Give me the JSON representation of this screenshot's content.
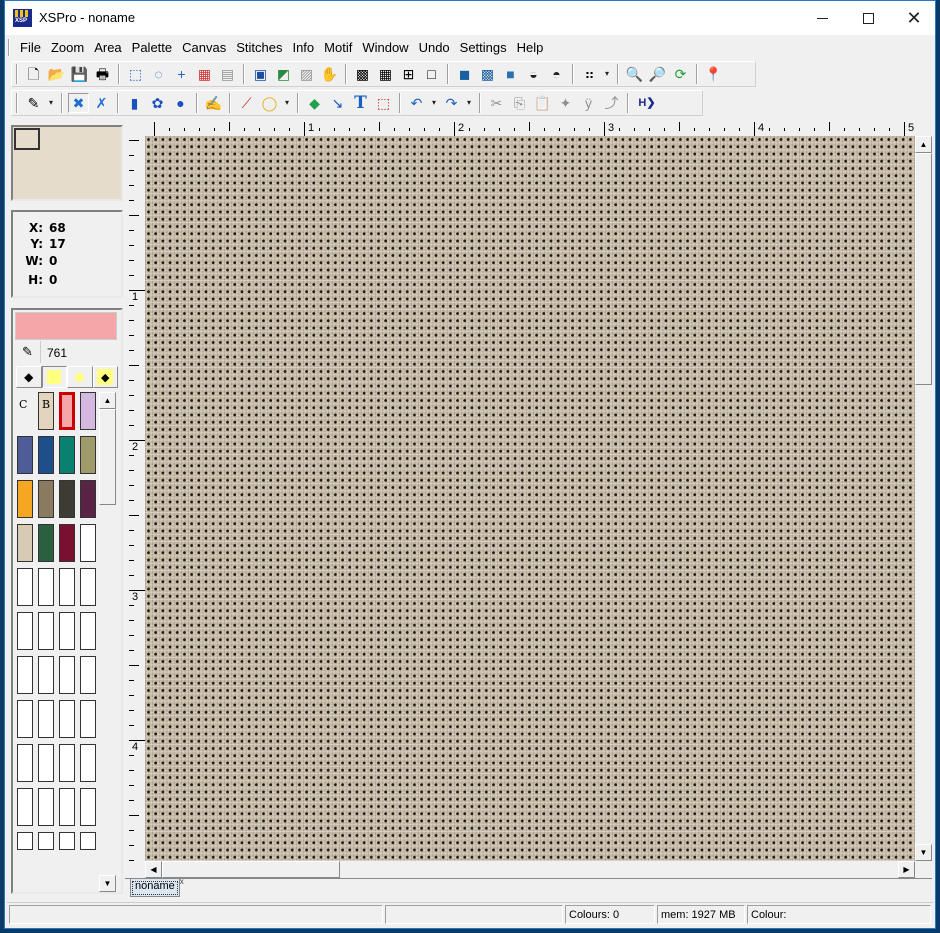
{
  "window": {
    "title": "XSPro - noname",
    "controls": {
      "minimize": "–",
      "maximize": "□",
      "close": "✕"
    }
  },
  "menu": [
    "File",
    "Zoom",
    "Area",
    "Palette",
    "Canvas",
    "Stitches",
    "Info",
    "Motif",
    "Window",
    "Undo",
    "Settings",
    "Help"
  ],
  "toolbar1": [
    {
      "name": "new-file-icon",
      "glyph": "🗋"
    },
    {
      "name": "open-folder-icon",
      "glyph": "📂"
    },
    {
      "name": "save-icon",
      "glyph": "💾"
    },
    {
      "name": "print-icon",
      "glyph": "🖶"
    },
    {
      "sep": true
    },
    {
      "name": "rect-select-icon",
      "glyph": "⬚"
    },
    {
      "name": "lasso-select-icon",
      "glyph": "◌"
    },
    {
      "name": "crosshair-icon",
      "glyph": "+"
    },
    {
      "name": "add-area-icon",
      "glyph": "▦"
    },
    {
      "name": "remove-area-icon",
      "glyph": "▤",
      "disabled": true
    },
    {
      "sep": true
    },
    {
      "name": "screen-view-icon",
      "glyph": "▣"
    },
    {
      "name": "pick-image-icon",
      "glyph": "◩"
    },
    {
      "name": "camera-icon",
      "glyph": "▨",
      "disabled": true
    },
    {
      "name": "hand-pan-icon",
      "glyph": "✋"
    },
    {
      "sep": true
    },
    {
      "name": "grid-fine-icon",
      "glyph": "▩"
    },
    {
      "name": "grid-dense-icon",
      "glyph": "▦"
    },
    {
      "name": "grid-lines-icon",
      "glyph": "⊞"
    },
    {
      "name": "grid-none-icon",
      "glyph": "□"
    },
    {
      "sep": true
    },
    {
      "name": "view-stitches-icon",
      "glyph": "◼"
    },
    {
      "name": "view-symbols-icon",
      "glyph": "▩"
    },
    {
      "name": "view-block-icon",
      "glyph": "■"
    },
    {
      "name": "view-bead-icon",
      "glyph": "◒"
    },
    {
      "name": "view-bead-white-icon",
      "glyph": "◓"
    },
    {
      "sep": true
    },
    {
      "name": "grid-dots-icon",
      "glyph": "⠶"
    },
    {
      "name": "grid-dots-dropdown",
      "glyph": "▾",
      "dd": true
    },
    {
      "sep": true
    },
    {
      "name": "zoom-in-icon",
      "glyph": "🔍"
    },
    {
      "name": "zoom-out-icon",
      "glyph": "🔎"
    },
    {
      "name": "refresh-icon",
      "glyph": "⟳"
    },
    {
      "sep": true
    },
    {
      "name": "colour-picker-icon",
      "glyph": "📍"
    }
  ],
  "toolbar2": [
    {
      "name": "pencil-icon",
      "glyph": "✎"
    },
    {
      "name": "pencil-dropdown",
      "glyph": "▾",
      "dd": true
    },
    {
      "sep": true
    },
    {
      "name": "full-cross-icon",
      "glyph": "✖",
      "active": true
    },
    {
      "name": "half-cross-icon",
      "glyph": "✗"
    },
    {
      "sep": true
    },
    {
      "name": "bead-long-icon",
      "glyph": "▮"
    },
    {
      "name": "french-knot-icon",
      "glyph": "✿"
    },
    {
      "name": "bead-round-icon",
      "glyph": "●"
    },
    {
      "sep": true
    },
    {
      "name": "backstitch-pen-icon",
      "glyph": "✍"
    },
    {
      "sep": true
    },
    {
      "name": "line-icon",
      "glyph": "⟋"
    },
    {
      "name": "circle-icon",
      "glyph": "◯"
    },
    {
      "name": "shape-dropdown",
      "glyph": "▾",
      "dd": true
    },
    {
      "sep": true
    },
    {
      "name": "fill-bucket-icon",
      "glyph": "◆"
    },
    {
      "name": "eyedropper-icon",
      "glyph": "↘"
    },
    {
      "name": "text-tool-icon",
      "glyph": "T"
    },
    {
      "name": "dotted-rect-icon",
      "glyph": "⬚"
    },
    {
      "sep": true
    },
    {
      "name": "undo-icon",
      "glyph": "↶"
    },
    {
      "name": "undo-dropdown",
      "glyph": "▾",
      "dd": true
    },
    {
      "name": "redo-icon",
      "glyph": "↷"
    },
    {
      "name": "redo-dropdown",
      "glyph": "▾",
      "dd": true
    },
    {
      "sep": true
    },
    {
      "name": "cut-icon",
      "glyph": "✂",
      "disabled": true
    },
    {
      "name": "copy-icon",
      "glyph": "⎘",
      "disabled": true
    },
    {
      "name": "paste-icon",
      "glyph": "📋",
      "disabled": true
    },
    {
      "name": "paste-special-icon",
      "glyph": "✦",
      "disabled": true
    },
    {
      "name": "mirror-icon",
      "glyph": "ÿ",
      "disabled": true
    },
    {
      "name": "rotate-icon",
      "glyph": "⤴",
      "disabled": true
    },
    {
      "sep": true
    },
    {
      "name": "h-next-icon",
      "glyph": "H❯"
    }
  ],
  "coords": {
    "x_label": "X:",
    "x": "68",
    "y_label": "Y:",
    "y": "17",
    "w_label": "W:",
    "w": "0",
    "h_label": "H:",
    "h": "0"
  },
  "palette": {
    "current_colour": "#f4a6a8",
    "colour_code": "761",
    "mode_buttons": [
      "full-diamond",
      "yellow-square",
      "yellow-dot",
      "yellow-diamond"
    ],
    "labels": {
      "c": "C",
      "b": "B"
    },
    "swatch_rows": [
      [
        "#e2d4bd",
        "#f4a6a8",
        "#d4b8e0"
      ],
      [
        "#4e5d96",
        "#1e4f8a",
        "#0a8070",
        "#9e9a6a"
      ],
      [
        "#f5a623",
        "#8a7a60",
        "#3c3c34",
        "#5a2446"
      ],
      [
        "#d8cbb4",
        "#2a6040",
        "#7a1030",
        "#ffffff"
      ]
    ],
    "selected_swatch": "#f4a6a8",
    "empty_rows": 7
  },
  "ruler": {
    "h_labels": [
      "1",
      "2",
      "3",
      "4",
      "5"
    ],
    "v_labels": [
      "1",
      "2",
      "3",
      "4"
    ]
  },
  "canvas": {
    "fabric_colour": "#c8bca9",
    "hole_colour": "#1e1a14"
  },
  "tabs": [
    {
      "label": "noname",
      "close": "x"
    }
  ],
  "status": {
    "cell1": "",
    "cell2": "",
    "colours": "Colours: 0",
    "mem": "mem: 1927 MB",
    "colour": "Colour:"
  }
}
